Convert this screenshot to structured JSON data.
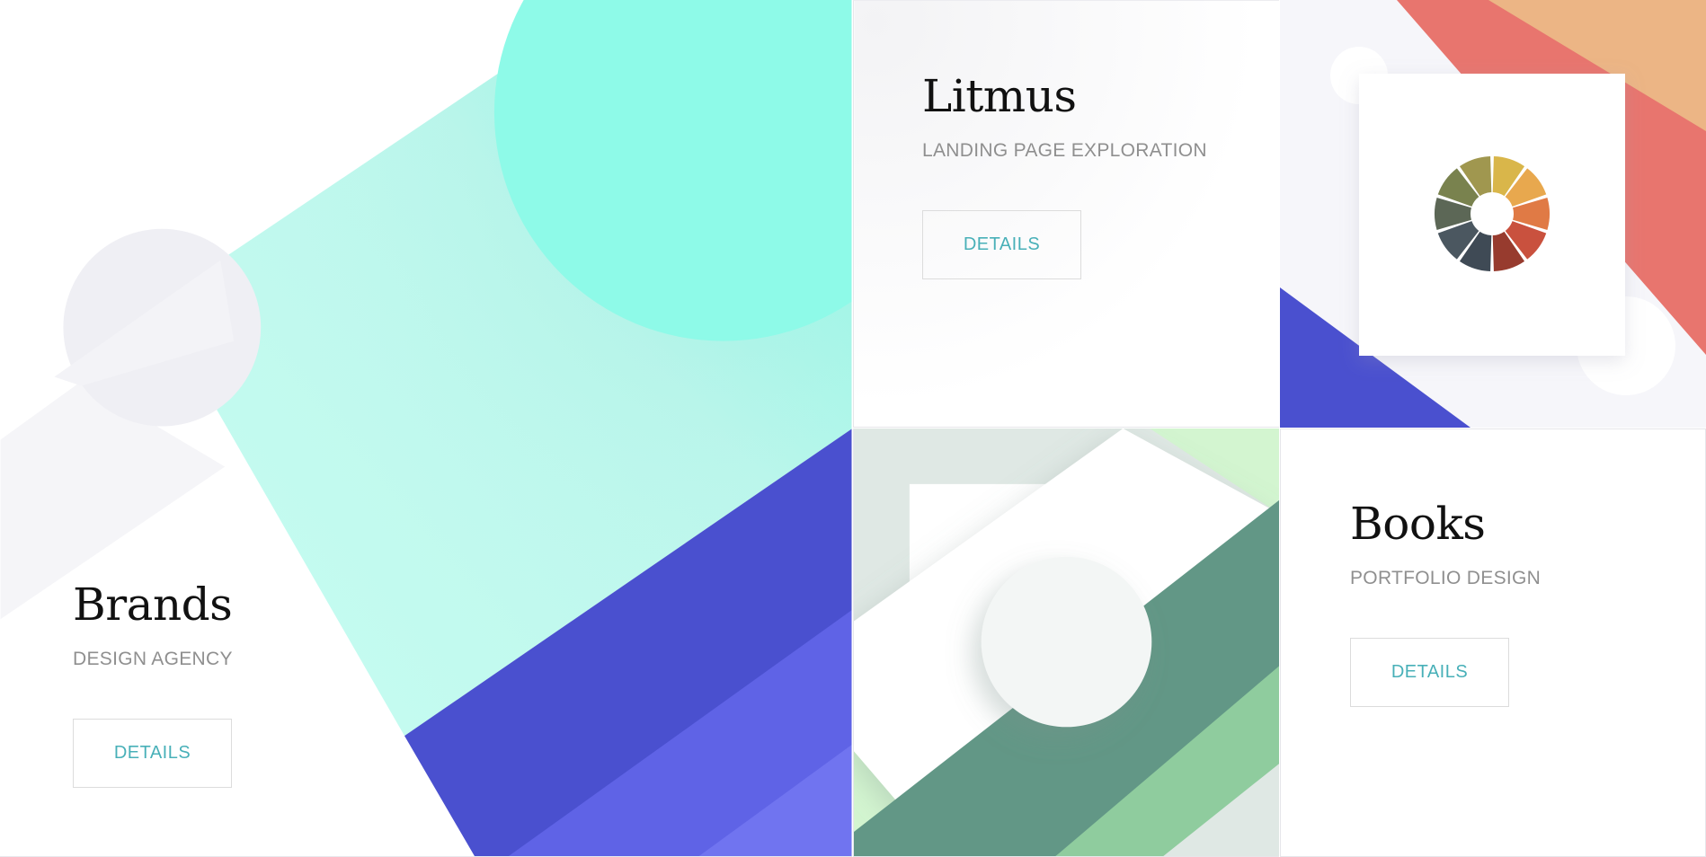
{
  "cards": {
    "brands": {
      "title": "Brands",
      "subtitle": "DESIGN AGENCY",
      "button_label": "DETAILS"
    },
    "litmus": {
      "title": "Litmus",
      "subtitle": "LANDING PAGE EXPLORATION",
      "button_label": "DETAILS"
    },
    "books": {
      "title": "Books",
      "subtitle": "PORTFOLIO DESIGN",
      "button_label": "DETAILS"
    }
  },
  "colors": {
    "accent_text": "#48b0b8",
    "mint": "#8efae8",
    "indigo": "#4a50cf",
    "coral": "#e8756e",
    "sage_green": "#629786"
  },
  "palette_wheel_colors": [
    "#d9b64a",
    "#e8a84e",
    "#e07a45",
    "#c9513e",
    "#973b2e",
    "#3f4a55",
    "#4b5760",
    "#5c6756",
    "#79824e",
    "#a0974f"
  ]
}
